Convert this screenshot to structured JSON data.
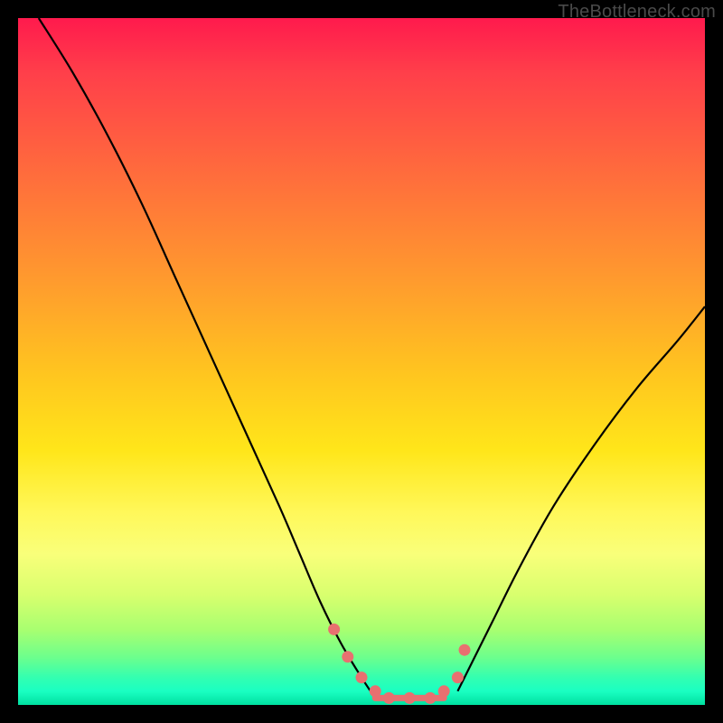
{
  "watermark": "TheBottleneck.com",
  "colors": {
    "frame": "#000000",
    "gradient_top": "#ff1a4d",
    "gradient_mid": "#ffe61a",
    "gradient_bottom": "#00e0a0",
    "curve": "#000000",
    "marker": "#e87070"
  },
  "chart_data": {
    "type": "line",
    "title": "",
    "xlabel": "",
    "ylabel": "",
    "xlim": [
      0,
      100
    ],
    "ylim": [
      0,
      100
    ],
    "series": [
      {
        "name": "left-curve",
        "x": [
          3,
          8,
          13,
          18,
          23,
          28,
          33,
          38,
          41,
          44,
          47,
          50,
          52
        ],
        "y": [
          100,
          92,
          83,
          73,
          62,
          51,
          40,
          29,
          22,
          15,
          9,
          4,
          1
        ]
      },
      {
        "name": "right-curve",
        "x": [
          64,
          66,
          69,
          73,
          78,
          84,
          90,
          96,
          100
        ],
        "y": [
          2,
          6,
          12,
          20,
          29,
          38,
          46,
          53,
          58
        ]
      }
    ],
    "markers": {
      "name": "bottleneck-points",
      "x": [
        46,
        48,
        50,
        52,
        54,
        57,
        60,
        62,
        64,
        65
      ],
      "y": [
        11,
        7,
        4,
        2,
        1,
        1,
        1,
        2,
        4,
        8
      ]
    },
    "trough": {
      "x_start": 52,
      "x_end": 62,
      "y": 1
    }
  }
}
